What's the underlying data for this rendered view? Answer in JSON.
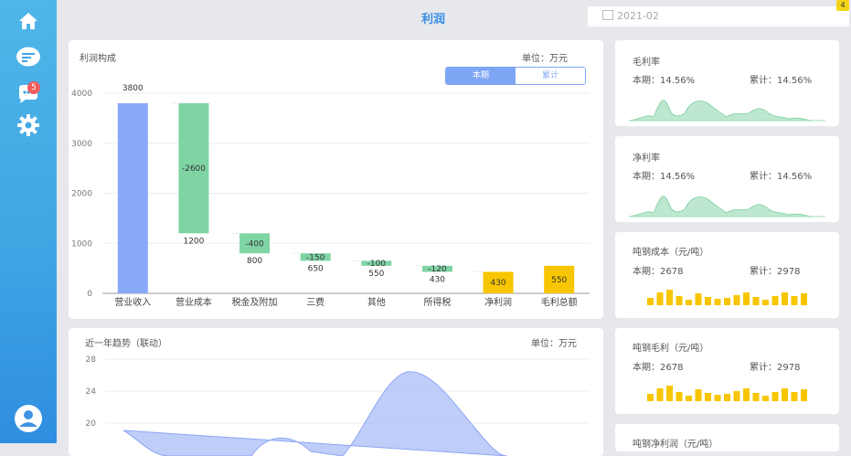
{
  "sidebar": {
    "items": [
      {
        "icon": "home-icon"
      },
      {
        "icon": "chat-list-icon"
      },
      {
        "icon": "message-icon",
        "badge": "5"
      },
      {
        "icon": "gear-icon"
      },
      {
        "icon": "user-icon"
      }
    ]
  },
  "header": {
    "title": "利润",
    "date": "2021-02",
    "date_badge": "4"
  },
  "profit_card": {
    "title": "利润构成",
    "unit": "单位：万元",
    "tabs": [
      "本期",
      "累计"
    ],
    "active_tab": "本期"
  },
  "trend_card": {
    "title": "近一年趋势（联动）",
    "unit": "单位：万元"
  },
  "kpis": [
    {
      "title": "毛利率",
      "current_label": "本期：14.56%",
      "total_label": "累计：14.56%"
    },
    {
      "title": "净利率",
      "current_label": "本期：14.56%",
      "total_label": "累计：14.56%"
    },
    {
      "title": "吨钢成本（元/吨）",
      "current_label": "本期：2678",
      "total_label": "累计：2978"
    },
    {
      "title": "吨钢毛利（元/吨）",
      "current_label": "本期：2678",
      "total_label": "累计：2978"
    },
    {
      "title": "吨钢净利润（元/吨）"
    }
  ],
  "chart_data": [
    {
      "type": "bar",
      "title": "利润构成",
      "categories": [
        "营业收入",
        "营业成本",
        "税金及附加",
        "三费",
        "其他",
        "所得税",
        "净利润",
        "毛利总额"
      ],
      "values": [
        3800,
        -2600,
        -400,
        -150,
        -100,
        -120,
        430,
        550
      ],
      "value_labels": [
        "3800",
        "-2600",
        "-400",
        "-150",
        "-100",
        "-120",
        "430",
        "550"
      ],
      "remaining_labels": [
        "",
        "1200",
        "800",
        "650",
        "550",
        "430",
        "",
        ""
      ],
      "ylim": [
        0,
        4000
      ],
      "yticks": [
        "0",
        "1000",
        "2000",
        "3000",
        "4000"
      ],
      "colors": {
        "income": "#8aa8f8",
        "cost": "#7fd4a4",
        "result": "#f7c600"
      }
    },
    {
      "type": "area",
      "title": "近一年趋势（联动）",
      "yticks": [
        "20",
        "24",
        "28"
      ],
      "ylim": [
        20,
        28
      ],
      "color": "#a9bdf7"
    }
  ]
}
